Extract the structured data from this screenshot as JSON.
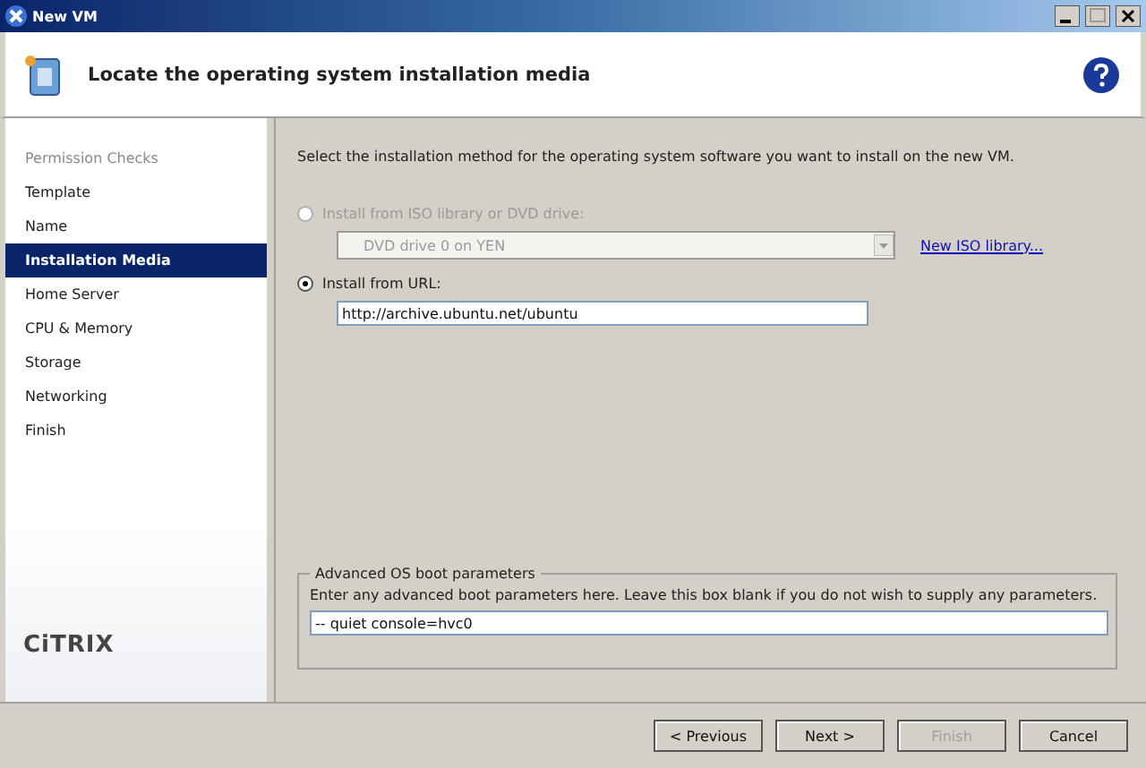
{
  "window": {
    "title": "New VM"
  },
  "header": {
    "title": "Locate the operating system installation media"
  },
  "sidebar": {
    "items": [
      {
        "label": "Permission Checks",
        "selected": false,
        "disabled": true
      },
      {
        "label": "Template",
        "selected": false,
        "disabled": false
      },
      {
        "label": "Name",
        "selected": false,
        "disabled": false
      },
      {
        "label": "Installation Media",
        "selected": true,
        "disabled": false
      },
      {
        "label": "Home Server",
        "selected": false,
        "disabled": false
      },
      {
        "label": "CPU & Memory",
        "selected": false,
        "disabled": false
      },
      {
        "label": "Storage",
        "selected": false,
        "disabled": false
      },
      {
        "label": "Networking",
        "selected": false,
        "disabled": false
      },
      {
        "label": "Finish",
        "selected": false,
        "disabled": false
      }
    ],
    "logo": "CiTRIX"
  },
  "intro": "Select the installation method for the operating system software you want to install on the new VM.",
  "options": [
    {
      "kind": "dropdown",
      "label": "Install from ISO library or DVD drive:",
      "selected": false,
      "disabled": true,
      "value": "DVD drive 0 on YEN",
      "link": "New ISO library..."
    },
    {
      "kind": "text",
      "label": "Install from URL:",
      "selected": true,
      "disabled": false,
      "value": "http://archive.ubuntu.net/ubuntu"
    }
  ],
  "boot": {
    "legend": "Advanced OS boot parameters",
    "hint": "Enter any advanced boot parameters here. Leave this box blank if you do not wish to supply any parameters.",
    "value": "-- quiet console=hvc0"
  },
  "buttons": [
    {
      "label": "< Previous",
      "disabled": false
    },
    {
      "label": "Next >",
      "disabled": false
    },
    {
      "label": "Finish",
      "disabled": true
    },
    {
      "label": "Cancel",
      "disabled": false
    }
  ]
}
